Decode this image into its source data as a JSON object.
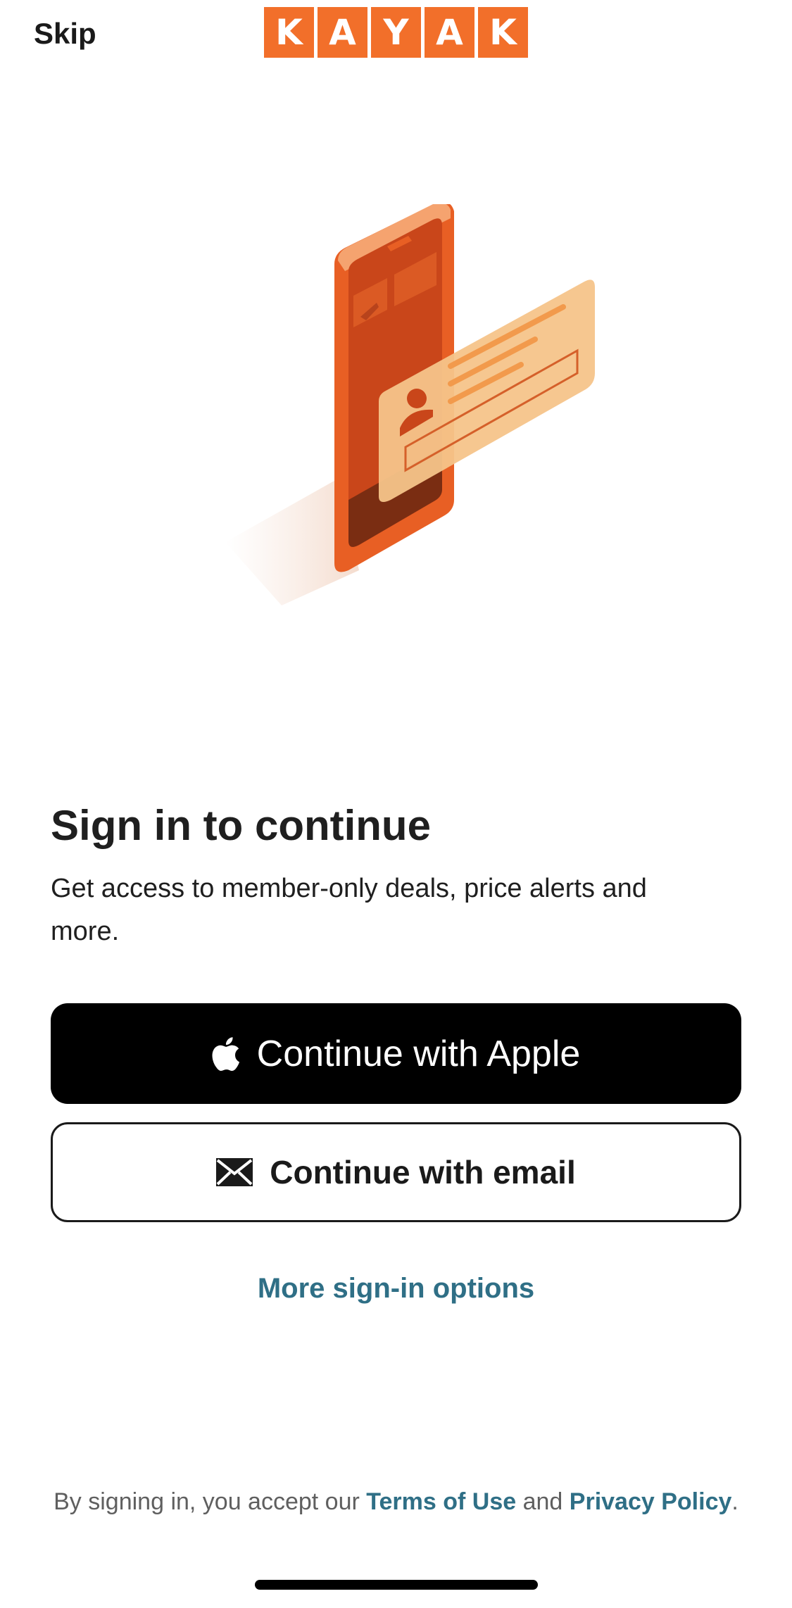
{
  "header": {
    "skip_label": "Skip",
    "logo_letters": [
      "K",
      "A",
      "Y",
      "A",
      "K"
    ]
  },
  "colors": {
    "brand_orange": "#f26f2a",
    "link_blue": "#2f6f86",
    "apple_button_bg": "#000000"
  },
  "main": {
    "title": "Sign in to continue",
    "subtitle": "Get access to member-only deals, price alerts and more.",
    "apple_button": {
      "label": "Continue with Apple",
      "icon": "apple-icon"
    },
    "email_button": {
      "label": "Continue with email",
      "icon": "envelope-icon"
    },
    "more_options_label": "More sign-in options"
  },
  "footer": {
    "legal_prefix": "By signing in, you accept our ",
    "terms_label": "Terms of Use",
    "legal_middle": " and ",
    "privacy_label": "Privacy Policy",
    "legal_suffix": "."
  }
}
